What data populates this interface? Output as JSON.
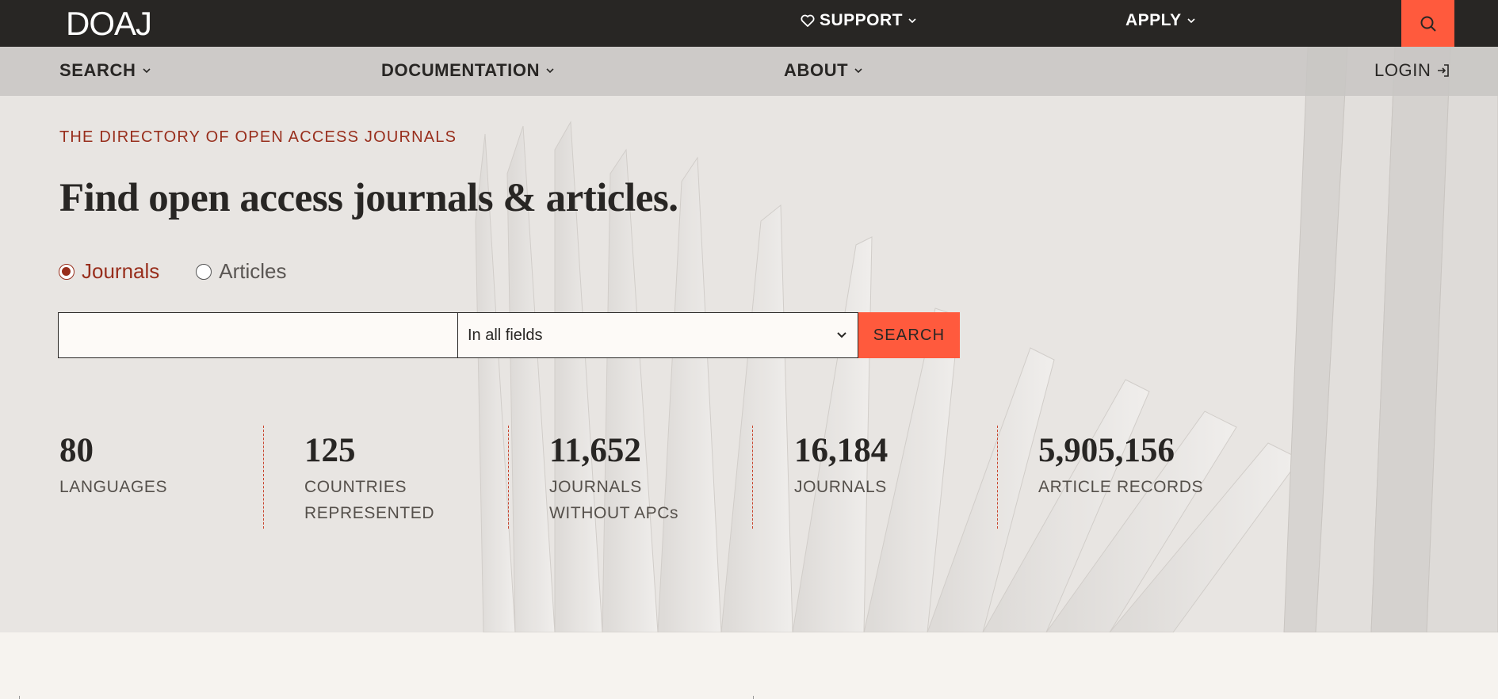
{
  "topbar": {
    "logo": "DOAJ",
    "support_label": "SUPPORT",
    "apply_label": "APPLY"
  },
  "subnav": {
    "search_label": "SEARCH",
    "documentation_label": "DOCUMENTATION",
    "about_label": "ABOUT",
    "login_label": "LOGIN"
  },
  "hero": {
    "eyebrow": "THE DIRECTORY OF OPEN ACCESS JOURNALS",
    "headline": "Find open access journals & articles."
  },
  "search_type": {
    "journals_label": "Journals",
    "articles_label": "Articles",
    "selected": "Journals"
  },
  "search": {
    "query_value": "",
    "field_select_value": "In all fields",
    "submit_label": "SEARCH"
  },
  "stats": [
    {
      "value": "80",
      "label": "LANGUAGES"
    },
    {
      "value": "125",
      "label": "COUNTRIES REPRESENTED"
    },
    {
      "value": "11,652",
      "label": "JOURNALS WITHOUT APCs"
    },
    {
      "value": "16,184",
      "label": "JOURNALS"
    },
    {
      "value": "5,905,156",
      "label": "ARTICLE RECORDS"
    }
  ],
  "colors": {
    "topbar_bg": "#282624",
    "accent": "#ff5a3d",
    "eyebrow_red": "#982e1c",
    "hero_bg": "#e8e5e2",
    "page_bg": "#f6f3ef"
  },
  "icons": {
    "support": "heart-icon",
    "top_search": "search-icon",
    "login": "login-arrow-icon",
    "dropdown": "chevron-down-icon"
  }
}
